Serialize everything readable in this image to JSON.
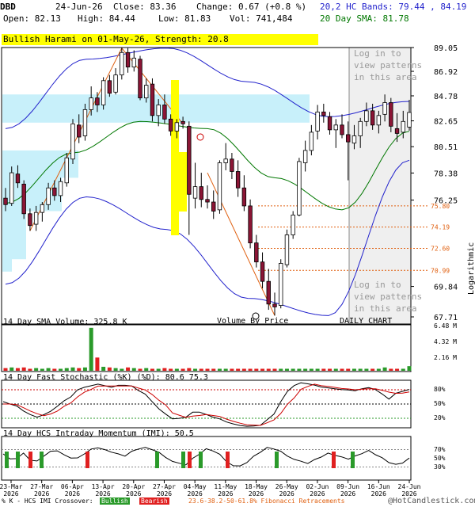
{
  "header": {
    "symbol": "DBD",
    "date": "24-Jun-26",
    "close": "Close: 83.36",
    "change": "Change: 0.67 (+0.8 %)",
    "open": "Open: 82.13",
    "high": "High: 84.44",
    "low": "Low: 81.83",
    "vol": "Vol: 741,484",
    "hc_bands": "20,2 HC Bands: 79.44 , 84.19",
    "sma": "20 Day SMA: 81.78"
  },
  "pattern_banner": "Bullish Harami on 01-May-26, Strength: 20.8",
  "overlay_top": [
    "Log in to",
    "view patterns",
    "in this area"
  ],
  "overlay_bottom": [
    "Log in to",
    "view patterns",
    "in this area"
  ],
  "price_panel": {
    "y_ticks": [
      "89.05",
      "86.92",
      "84.78",
      "82.65",
      "80.51",
      "78.38",
      "76.25",
      "69.84",
      "67.71"
    ],
    "fib_labels": [
      "75.80",
      "74.19",
      "72.60",
      "70.99"
    ],
    "volume_by_price_label": "Volume By Price",
    "daily_chart_label": "DAILY CHART",
    "scale_label": "Logarithmic"
  },
  "volume_panel": {
    "title": "14 Day SMA Volume: 325.8 K",
    "y_ticks": [
      "6.48 M",
      "4.32 M",
      "2.16 M"
    ]
  },
  "stoch_panel": {
    "title": "14 Day Fast Stochastic (%K) (%D): 80.6  75.3",
    "y_ticks": [
      "80%",
      "50%",
      "20%"
    ]
  },
  "imi_panel": {
    "title": "14 Day HCS Intraday Momentum (IMI): 50.5",
    "y_ticks": [
      "70%",
      "50%",
      "30%"
    ]
  },
  "x_ticks": [
    {
      "line1": "23-Mar",
      "line2": "2026"
    },
    {
      "line1": "27-Mar",
      "line2": "2026"
    },
    {
      "line1": "06-Apr",
      "line2": "2026"
    },
    {
      "line1": "13-Apr",
      "line2": "2026"
    },
    {
      "line1": "20-Apr",
      "line2": "2026"
    },
    {
      "line1": "27-Apr",
      "line2": "2026"
    },
    {
      "line1": "04-May",
      "line2": "2026"
    },
    {
      "line1": "11-May",
      "line2": "2026"
    },
    {
      "line1": "18-May",
      "line2": "2026"
    },
    {
      "line1": "26-May",
      "line2": "2026"
    },
    {
      "line1": "02-Jun",
      "line2": "2026"
    },
    {
      "line1": "09-Jun",
      "line2": "2026"
    },
    {
      "line1": "16-Jun",
      "line2": "2026"
    },
    {
      "line1": "24-Jun",
      "line2": "2026"
    }
  ],
  "footer": {
    "legend_text": "% K - HCS IMI Crossover:",
    "bullish": "Bullish",
    "bearish": "Bearish",
    "fib": "23.6-38.2-50-61.8% Fibonacci Retracements",
    "copyright": "@HotCandlestick.com"
  },
  "colors": {
    "up_body": "#ffffff",
    "down_body": "#8b1535",
    "band": "#2222cc",
    "sma": "#007700",
    "fib": "#e06010",
    "vbp": "#c8f0fa",
    "highlight": "#ffff00",
    "bull": "#2a9a2a",
    "bear": "#e02020"
  },
  "chart_data": {
    "type": "candlestick",
    "ylim": [
      67.71,
      89.05
    ],
    "y_scale": "log",
    "dates": [
      "23-Mar",
      "24-Mar",
      "25-Mar",
      "26-Mar",
      "27-Mar",
      "30-Mar",
      "31-Mar",
      "01-Apr",
      "02-Apr",
      "03-Apr",
      "06-Apr",
      "07-Apr",
      "08-Apr",
      "09-Apr",
      "10-Apr",
      "13-Apr",
      "14-Apr",
      "15-Apr",
      "16-Apr",
      "17-Apr",
      "20-Apr",
      "21-Apr",
      "22-Apr",
      "23-Apr",
      "24-Apr",
      "27-Apr",
      "28-Apr",
      "29-Apr",
      "30-Apr",
      "01-May",
      "04-May",
      "05-May",
      "06-May",
      "07-May",
      "08-May",
      "11-May",
      "12-May",
      "13-May",
      "14-May",
      "15-May",
      "18-May",
      "19-May",
      "20-May",
      "21-May",
      "22-May",
      "26-May",
      "27-May",
      "28-May",
      "29-May",
      "01-Jun",
      "02-Jun",
      "03-Jun",
      "04-Jun",
      "05-Jun",
      "08-Jun",
      "09-Jun",
      "10-Jun",
      "11-Jun",
      "12-Jun",
      "15-Jun",
      "16-Jun",
      "17-Jun",
      "18-Jun",
      "19-Jun",
      "22-Jun",
      "23-Jun",
      "24-Jun"
    ],
    "ohlc": [
      [
        76.4,
        77.2,
        75.4,
        75.9
      ],
      [
        76.0,
        78.9,
        75.8,
        78.4
      ],
      [
        78.3,
        79.0,
        77.2,
        77.6
      ],
      [
        77.5,
        77.8,
        74.8,
        75.2
      ],
      [
        75.2,
        75.6,
        73.9,
        74.3
      ],
      [
        74.4,
        75.8,
        73.9,
        75.3
      ],
      [
        75.3,
        76.1,
        74.6,
        75.9
      ],
      [
        75.9,
        77.6,
        75.5,
        77.2
      ],
      [
        77.2,
        77.8,
        76.2,
        76.6
      ],
      [
        76.6,
        78.0,
        76.1,
        77.7
      ],
      [
        77.6,
        80.0,
        77.3,
        79.6
      ],
      [
        79.5,
        82.8,
        79.1,
        82.4
      ],
      [
        82.3,
        83.2,
        80.8,
        81.3
      ],
      [
        81.4,
        84.1,
        81.0,
        83.6
      ],
      [
        83.6,
        85.6,
        83.1,
        84.6
      ],
      [
        84.6,
        85.1,
        83.4,
        84.0
      ],
      [
        84.0,
        86.4,
        83.6,
        86.1
      ],
      [
        86.1,
        86.6,
        84.7,
        85.0
      ],
      [
        85.1,
        87.2,
        84.9,
        86.6
      ],
      [
        86.6,
        89.0,
        86.2,
        88.6
      ],
      [
        88.6,
        89.0,
        86.8,
        87.3
      ],
      [
        87.3,
        88.8,
        86.9,
        88.1
      ],
      [
        88.0,
        88.3,
        84.4,
        84.6
      ],
      [
        84.6,
        86.3,
        84.2,
        85.7
      ],
      [
        85.8,
        86.3,
        82.6,
        83.1
      ],
      [
        83.1,
        84.5,
        82.2,
        84.0
      ],
      [
        84.0,
        84.9,
        82.4,
        82.8
      ],
      [
        82.8,
        83.2,
        81.4,
        81.8
      ],
      [
        81.8,
        82.8,
        81.2,
        82.5
      ],
      [
        82.6,
        83.0,
        82.0,
        82.4
      ],
      [
        82.2,
        82.6,
        73.6,
        76.7
      ],
      [
        76.4,
        79.2,
        75.6,
        77.3
      ],
      [
        77.3,
        78.4,
        75.7,
        76.3
      ],
      [
        76.3,
        77.4,
        75.6,
        76.1
      ],
      [
        76.1,
        77.0,
        74.8,
        75.4
      ],
      [
        75.5,
        79.4,
        75.2,
        79.2
      ],
      [
        79.2,
        80.8,
        78.6,
        79.5
      ],
      [
        79.5,
        80.0,
        77.9,
        78.5
      ],
      [
        78.5,
        79.4,
        76.5,
        77.2
      ],
      [
        77.2,
        78.2,
        75.4,
        75.8
      ],
      [
        75.8,
        76.3,
        72.6,
        73.0
      ],
      [
        73.0,
        73.6,
        71.2,
        71.6
      ],
      [
        71.6,
        72.3,
        69.7,
        70.2
      ],
      [
        70.2,
        71.1,
        68.2,
        68.6
      ],
      [
        68.6,
        69.4,
        67.8,
        68.4
      ],
      [
        68.5,
        71.8,
        68.3,
        71.5
      ],
      [
        71.4,
        74.0,
        71.2,
        73.6
      ],
      [
        73.6,
        75.4,
        73.3,
        75.1
      ],
      [
        75.1,
        79.6,
        75.0,
        79.3
      ],
      [
        79.2,
        81.0,
        78.5,
        80.2
      ],
      [
        80.2,
        82.3,
        79.8,
        81.7
      ],
      [
        81.8,
        84.0,
        81.1,
        83.4
      ],
      [
        83.4,
        84.1,
        82.5,
        83.1
      ],
      [
        83.0,
        83.4,
        81.5,
        81.9
      ],
      [
        81.9,
        82.8,
        80.4,
        82.3
      ],
      [
        82.3,
        83.2,
        81.2,
        81.5
      ],
      [
        81.5,
        82.6,
        77.8,
        80.9
      ],
      [
        80.8,
        82.3,
        80.3,
        81.4
      ],
      [
        81.4,
        82.9,
        80.4,
        82.6
      ],
      [
        82.6,
        84.2,
        82.2,
        83.5
      ],
      [
        83.5,
        84.1,
        81.9,
        82.3
      ],
      [
        82.3,
        83.5,
        81.6,
        83.1
      ],
      [
        83.2,
        84.9,
        82.6,
        84.2
      ],
      [
        84.2,
        84.6,
        81.7,
        82.2
      ],
      [
        82.0,
        83.3,
        80.9,
        81.6
      ],
      [
        81.7,
        83.5,
        81.2,
        82.6
      ],
      [
        82.13,
        84.44,
        81.83,
        83.36
      ]
    ],
    "hc_band_upper": [
      82.0,
      88.0,
      89.0,
      86.0,
      83.0,
      84.3
    ],
    "hc_band_lower": [
      70.0,
      76.5,
      74.0,
      69.0,
      67.8,
      79.4
    ],
    "sma_20": [
      76.0,
      80.0,
      82.6,
      82.0,
      78.0,
      75.5,
      81.78
    ],
    "fibonacci": [
      75.8,
      74.19,
      72.6,
      70.99
    ],
    "volume_sma_14": "325.8 K",
    "stochastic": {
      "k": 80.6,
      "d": 75.3
    },
    "imi": 50.5
  }
}
